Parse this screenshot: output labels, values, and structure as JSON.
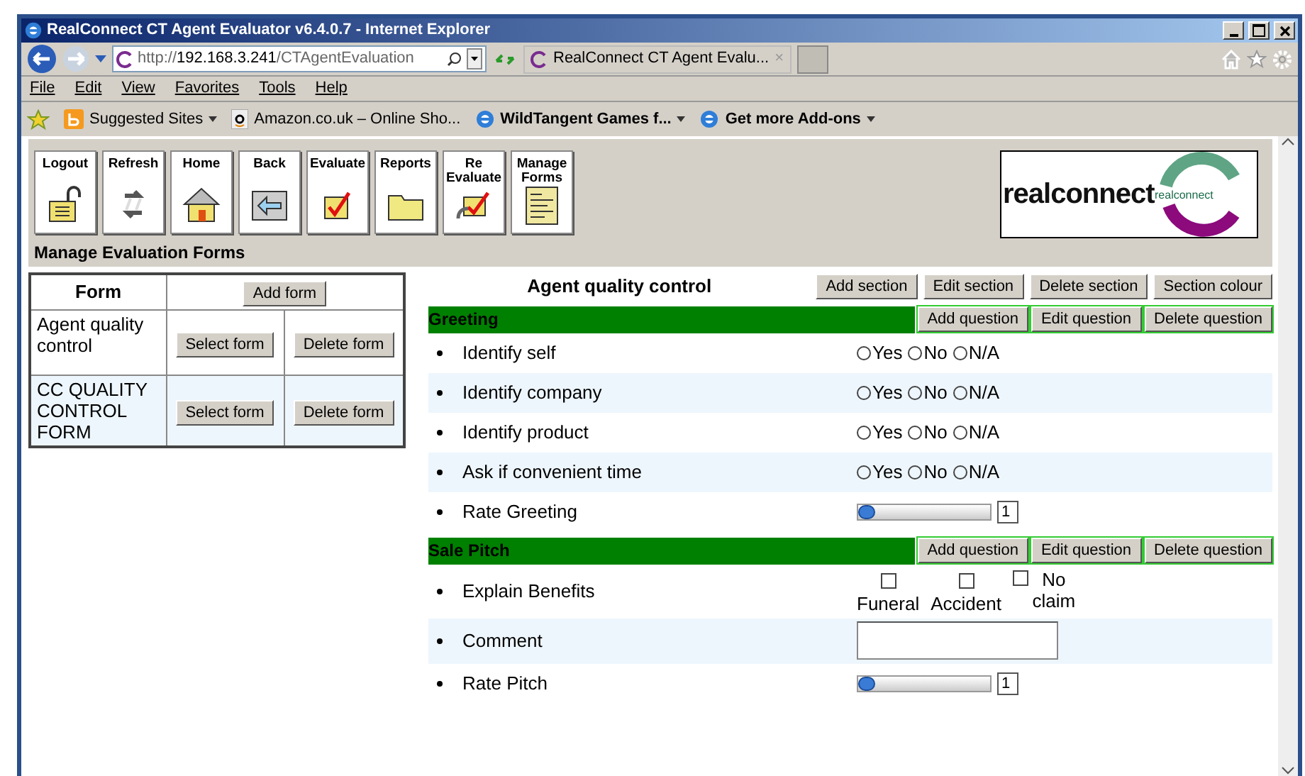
{
  "window": {
    "title": "RealConnect CT Agent Evaluator v6.4.0.7 - Internet Explorer"
  },
  "address": {
    "url_host": "http://192.168.3.241/",
    "url_path": "CTAgentEvaluation"
  },
  "browser_tab": {
    "title": "RealConnect CT Agent Evalu...",
    "close": "×"
  },
  "menu": [
    "File",
    "Edit",
    "View",
    "Favorites",
    "Tools",
    "Help"
  ],
  "favorites": [
    {
      "label": "Suggested Sites",
      "dropdown": true,
      "bold": false
    },
    {
      "label": "Amazon.co.uk – Online Sho...",
      "dropdown": false,
      "bold": false
    },
    {
      "label": "WildTangent Games f...",
      "dropdown": true,
      "bold": true
    },
    {
      "label": "Get more Add-ons",
      "dropdown": true,
      "bold": true
    }
  ],
  "toolbar": [
    {
      "label": "Logout"
    },
    {
      "label": "Refresh"
    },
    {
      "label": "Home"
    },
    {
      "label": "Back"
    },
    {
      "label": "Evaluate"
    },
    {
      "label": "Reports"
    },
    {
      "label": "Re Evaluate"
    },
    {
      "label": "Manage Forms"
    }
  ],
  "logo": {
    "text": "realconnect",
    "small_text": "realconnect"
  },
  "page_heading": "Manage Evaluation Forms",
  "forms_table": {
    "header": "Form",
    "add_button": "Add form",
    "rows": [
      {
        "name": "Agent quality control",
        "select": "Select form",
        "delete": "Delete form"
      },
      {
        "name": "CC QUALITY CONTROL FORM",
        "select": "Select form",
        "delete": "Delete form"
      }
    ]
  },
  "form": {
    "title": "Agent quality control",
    "buttons": [
      "Add section",
      "Edit section",
      "Delete section",
      "Section colour"
    ],
    "sections": [
      {
        "name": "Greeting",
        "color": "#008000",
        "buttons": [
          "Add question",
          "Edit question",
          "Delete question"
        ],
        "questions": [
          {
            "kind": "radio",
            "label": "Identify self",
            "options": [
              {
                "label": "Yes",
                "selected": false
              },
              {
                "label": "No",
                "selected": false
              },
              {
                "label": "N/A",
                "selected": false
              }
            ]
          },
          {
            "kind": "radio",
            "label": "Identify company",
            "options": [
              {
                "label": "Yes",
                "selected": false
              },
              {
                "label": "No",
                "selected": false
              },
              {
                "label": "N/A",
                "selected": false
              }
            ]
          },
          {
            "kind": "radio",
            "label": "Identify product",
            "options": [
              {
                "label": "Yes",
                "selected": false
              },
              {
                "label": "No",
                "selected": false
              },
              {
                "label": "N/A",
                "selected": false
              }
            ]
          },
          {
            "kind": "radio",
            "label": "Ask if convenient time",
            "options": [
              {
                "label": "Yes",
                "selected": false
              },
              {
                "label": "No",
                "selected": false
              },
              {
                "label": "N/A",
                "selected": false
              }
            ]
          },
          {
            "kind": "slider",
            "label": "Rate Greeting",
            "level": 0,
            "value": "1"
          }
        ]
      },
      {
        "name": "Sale Pitch",
        "color": "#008000",
        "buttons": [
          "Add question",
          "Edit question",
          "Delete question"
        ],
        "questions": [
          {
            "kind": "checkbox",
            "label": "Explain Benefits",
            "options": [
              {
                "label": "Funeral",
                "checked": false
              },
              {
                "label": "Accident",
                "checked": false
              },
              {
                "label": "No claim",
                "checked": false
              }
            ]
          },
          {
            "kind": "text",
            "label": "Comment"
          },
          {
            "kind": "slider",
            "label": "Rate Pitch",
            "level": 0,
            "value": "1"
          }
        ]
      }
    ]
  }
}
